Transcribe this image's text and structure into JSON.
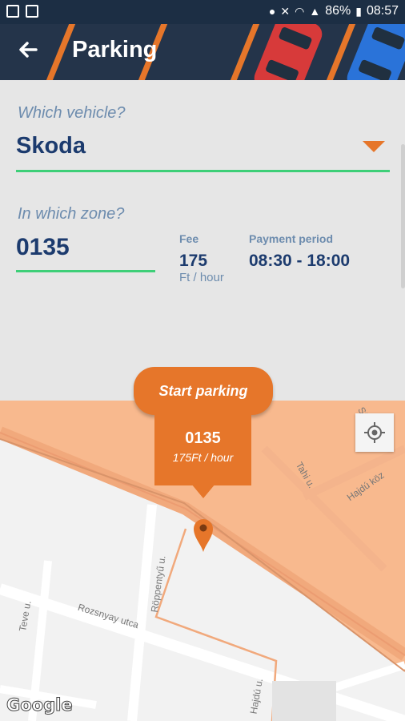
{
  "status_bar": {
    "battery": "86%",
    "time": "08:57",
    "icons": [
      "location-icon",
      "mute-icon",
      "wifi-icon",
      "signal-icon",
      "battery-icon"
    ]
  },
  "header": {
    "title": "Parking",
    "back_icon": "arrow-left-icon"
  },
  "form": {
    "vehicle_label": "Which vehicle?",
    "vehicle_value": "Skoda",
    "zone_label": "In which zone?",
    "zone_value": "0135",
    "fee_label": "Fee",
    "fee_value": "175",
    "fee_unit": "Ft / hour",
    "period_label": "Payment period",
    "period_value": "08:30 - 18:00"
  },
  "map": {
    "start_button": "Start parking",
    "zone_card_number": "0135",
    "zone_card_rate": "175Ft / hour",
    "streets": [
      "Tahi u.",
      "Hajdú köz",
      "Röppentyű u.",
      "Rozsnyay utca",
      "Teve u.",
      "Hajdú u.",
      "Süba u."
    ],
    "attribution": "Google"
  },
  "colors": {
    "accent": "#e6762a",
    "header_bg": "#24344a",
    "underline": "#3ecf78",
    "primary_text": "#1c3b6e",
    "label_text": "#6d8cae"
  }
}
